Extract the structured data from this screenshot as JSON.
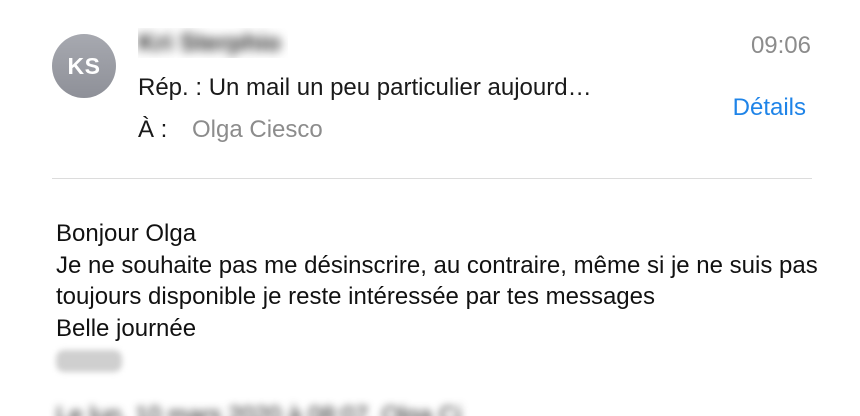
{
  "header": {
    "avatar_initials": "KS",
    "time": "09:06",
    "subject": "Rép. : Un mail un peu particulier aujourd…",
    "details_label": "Détails",
    "to_label": "À :",
    "to_name": "Olga Ciesco"
  },
  "body": {
    "lines": [
      "Bonjour Olga",
      "Je ne souhaite pas me désinscrire, au contraire, même si je ne suis pas toujours disponible je reste intéressée par tes messages",
      "Belle journée"
    ]
  },
  "colors": {
    "accent": "#1f84e8",
    "avatar": "#9b9da4",
    "secondary_text": "#8c8c8c"
  }
}
